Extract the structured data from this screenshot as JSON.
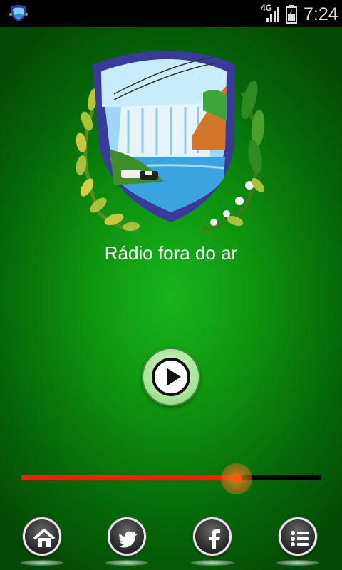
{
  "status_bar": {
    "network": "4G",
    "time": "7:24"
  },
  "player": {
    "status_text": "Rádio fora do ar",
    "volume_level": 0.72
  },
  "colors": {
    "background_center": "#17b51a",
    "background_edge": "#034a05",
    "slider_fill": "#ff1a0a",
    "slider_thumb": "#ff5a10"
  },
  "nav": {
    "items": [
      {
        "icon": "home-icon"
      },
      {
        "icon": "twitter-icon"
      },
      {
        "icon": "facebook-icon"
      },
      {
        "icon": "menu-list-icon"
      }
    ]
  }
}
